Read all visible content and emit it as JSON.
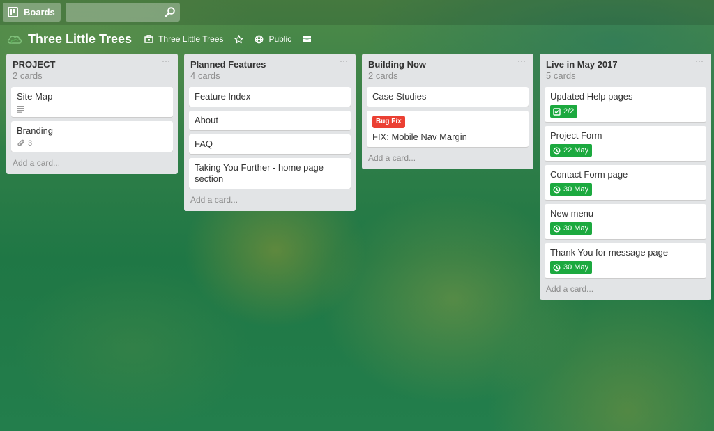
{
  "header": {
    "boards_label": "Boards",
    "search": {
      "value": "",
      "placeholder": ""
    }
  },
  "board": {
    "title": "Three Little Trees",
    "team": "Three Little Trees",
    "visibility": "Public"
  },
  "lists": [
    {
      "title": "PROJECT",
      "count": "2 cards",
      "add_card": "Add a card...",
      "cards": [
        {
          "title": "Site Map",
          "badge_icon": "description-icon"
        },
        {
          "title": "Branding",
          "badge_icon": "attachment-icon",
          "badge_text": "3"
        }
      ]
    },
    {
      "title": "Planned Features",
      "count": "4 cards",
      "add_card": "Add a card...",
      "cards": [
        {
          "title": "Feature Index"
        },
        {
          "title": "About"
        },
        {
          "title": "FAQ"
        },
        {
          "title": "Taking You Further - home page section"
        }
      ]
    },
    {
      "title": "Building Now",
      "count": "2 cards",
      "add_card": "Add a card...",
      "cards": [
        {
          "title": "Case Studies"
        },
        {
          "title": "FIX: Mobile Nav Margin",
          "label": "Bug Fix",
          "label_color": "#eb4033"
        }
      ]
    },
    {
      "title": "Live in May 2017",
      "count": "5 cards",
      "add_card": "Add a card...",
      "cards": [
        {
          "title": "Updated Help pages",
          "badge_icon": "checklist-icon",
          "badge_text": "2/2",
          "badge_color": "#1ca93f"
        },
        {
          "title": "Project Form",
          "badge_icon": "clock-icon",
          "badge_text": "22 May",
          "badge_color": "#1ca93f"
        },
        {
          "title": "Contact Form page",
          "badge_icon": "clock-icon",
          "badge_text": "30 May",
          "badge_color": "#1ca93f"
        },
        {
          "title": "New menu",
          "badge_icon": "clock-icon",
          "badge_text": "30 May",
          "badge_color": "#1ca93f"
        },
        {
          "title": "Thank You for message page",
          "badge_icon": "clock-icon",
          "badge_text": "30 May",
          "badge_color": "#1ca93f"
        }
      ]
    }
  ]
}
